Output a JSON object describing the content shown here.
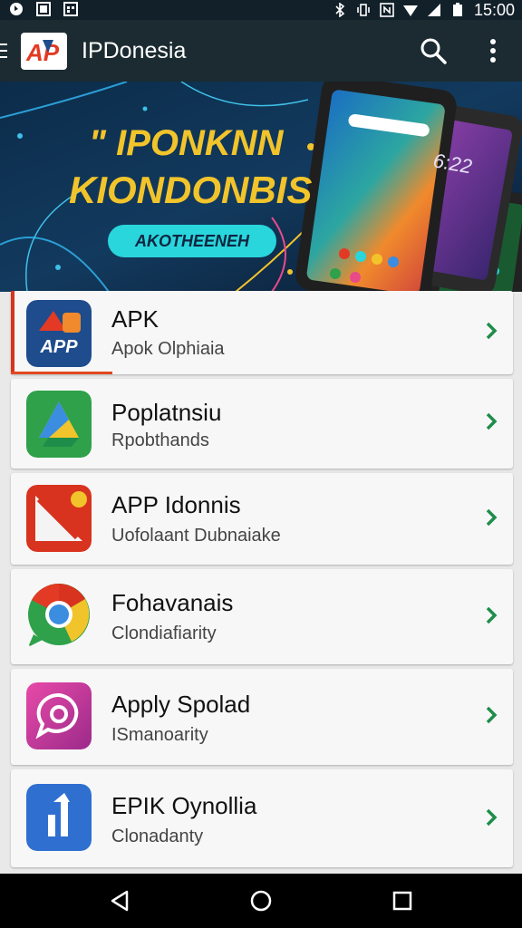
{
  "status_bar": {
    "time": "15:00",
    "left_icons": [
      "notification-icon",
      "image-icon",
      "calendar-icon"
    ],
    "right_icons": [
      "bluetooth-icon",
      "vibrate-icon",
      "nfc-icon",
      "wifi-icon",
      "signal-icon",
      "battery-icon"
    ]
  },
  "app_bar": {
    "logo_text": "AP",
    "title": "IPDonesia",
    "icons": [
      "menu-icon",
      "search-icon",
      "more-vert-icon"
    ]
  },
  "banner": {
    "line1": "\" IPONKNN",
    "line2": "KIONDONBIS",
    "button": "AKOTHEENEH",
    "phone_time": "6:22"
  },
  "list": [
    {
      "title": "APK",
      "subtitle": "Apok Olphiaia",
      "icon": "app-logo-icon",
      "icon_text": "APP"
    },
    {
      "title": "Poplatnsiu",
      "subtitle": "Rpobthands",
      "icon": "drive-icon"
    },
    {
      "title": "APP Idonnis",
      "subtitle": "Uofolaant Dubnaiake",
      "icon": "flag-icon"
    },
    {
      "title": "Fohavanais",
      "subtitle": "Clondiafiarity",
      "icon": "chrome-icon"
    },
    {
      "title": "Apply Spolad",
      "subtitle": "ISmanoarity",
      "icon": "chat-bubble-icon"
    },
    {
      "title": "EPIK Oynollia",
      "subtitle": "Clonadanty",
      "icon": "stats-icon"
    }
  ],
  "colors": {
    "app_bar": "#1b2b31",
    "accent_green": "#1e8d4a",
    "banner_text": "#f2c42b",
    "banner_button": "#29d6dc"
  },
  "nav_bar": {
    "buttons": [
      "back-icon",
      "home-icon",
      "recents-icon"
    ]
  }
}
